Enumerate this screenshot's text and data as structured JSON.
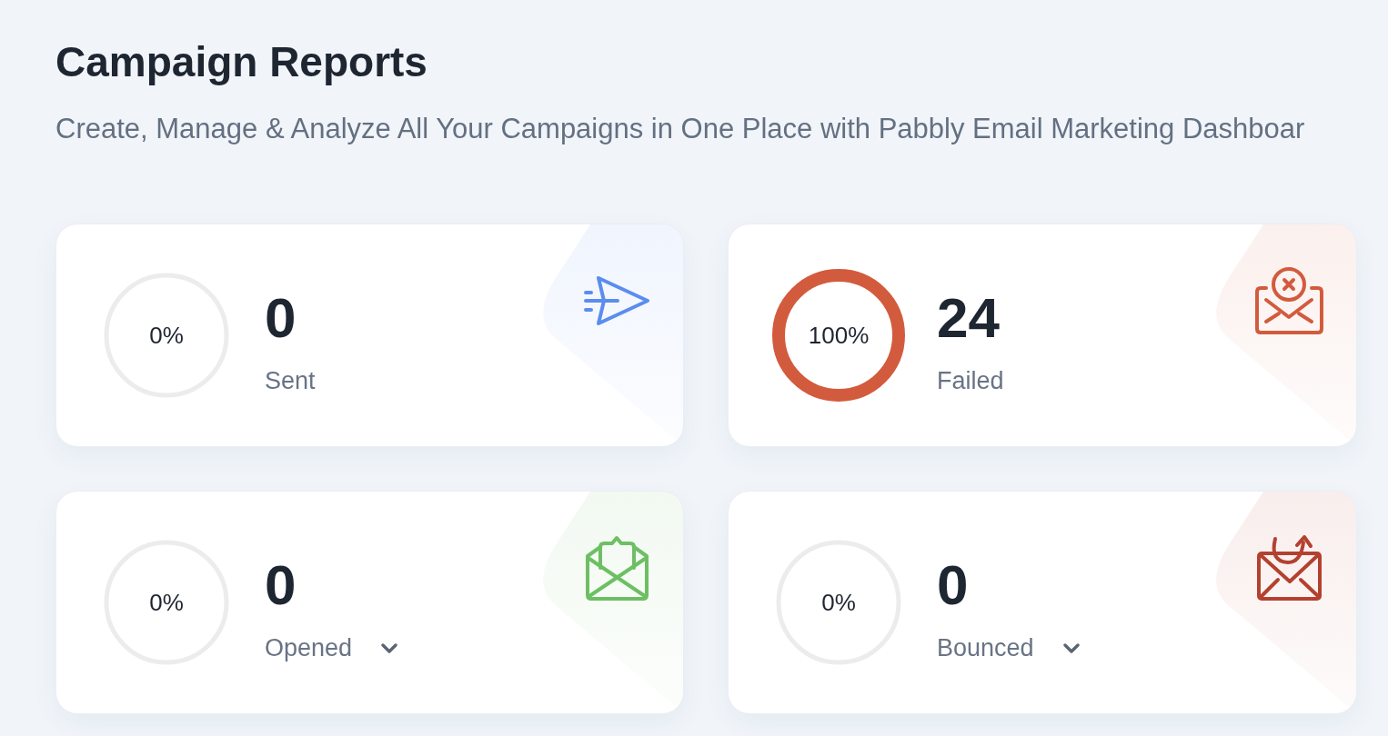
{
  "header": {
    "title": "Campaign Reports",
    "subtitle": "Create, Manage & Analyze All Your Campaigns in One Place with Pabbly Email Marketing Dashboar"
  },
  "cards": [
    {
      "kind": "sent",
      "color": "#5b8def",
      "level": 0,
      "percent": "0%",
      "value": "0",
      "label": "Sent",
      "expandable": false
    },
    {
      "kind": "failed",
      "color": "#d35b3d",
      "level": 1,
      "percent": "100%",
      "value": "24",
      "label": "Failed",
      "expandable": false
    },
    {
      "kind": "opened",
      "color": "#6dbf63",
      "level": 0,
      "percent": "0%",
      "value": "0",
      "label": "Opened",
      "expandable": true
    },
    {
      "kind": "bounced",
      "color": "#b4412f",
      "level": 0,
      "percent": "0%",
      "value": "0",
      "label": "Bounced",
      "expandable": true
    }
  ]
}
